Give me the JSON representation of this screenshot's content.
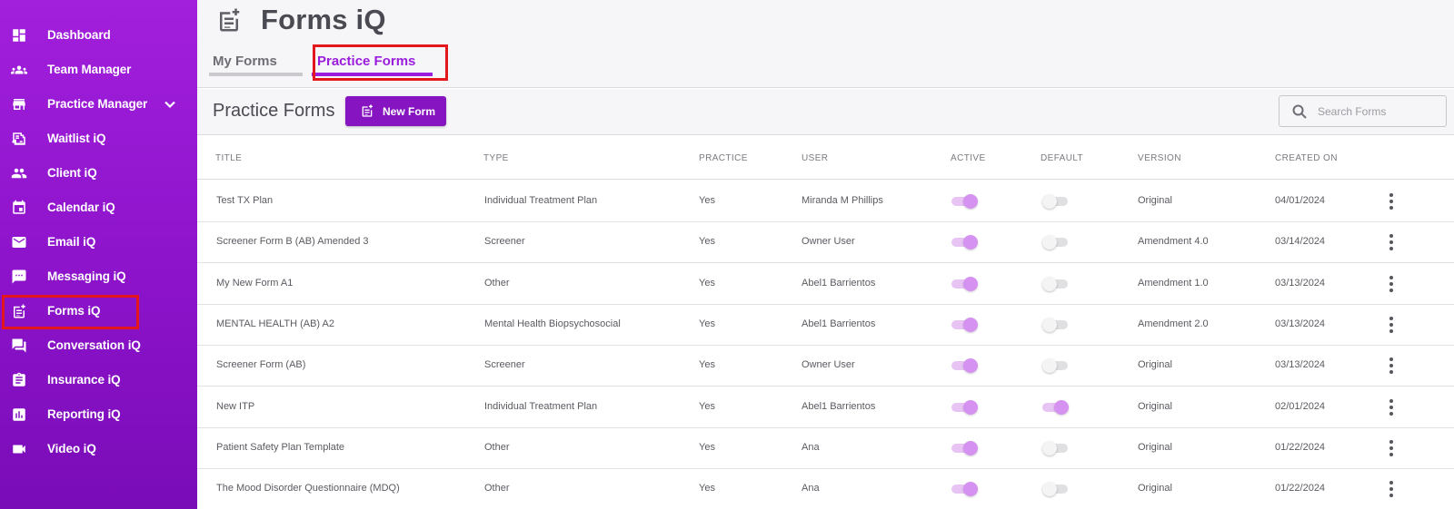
{
  "sidebar": {
    "items": [
      {
        "label": "Dashboard",
        "icon": "dashboard-icon"
      },
      {
        "label": "Team Manager",
        "icon": "team-icon"
      },
      {
        "label": "Practice Manager",
        "icon": "store-icon",
        "expandable": true
      },
      {
        "label": "Waitlist iQ",
        "icon": "waitlist-icon"
      },
      {
        "label": "Client iQ",
        "icon": "client-icon"
      },
      {
        "label": "Calendar iQ",
        "icon": "calendar-icon"
      },
      {
        "label": "Email iQ",
        "icon": "email-icon"
      },
      {
        "label": "Messaging iQ",
        "icon": "messaging-icon"
      },
      {
        "label": "Forms iQ",
        "icon": "forms-icon",
        "active": true
      },
      {
        "label": "Conversation iQ",
        "icon": "conversation-icon"
      },
      {
        "label": "Insurance iQ",
        "icon": "insurance-icon"
      },
      {
        "label": "Reporting iQ",
        "icon": "reporting-icon"
      },
      {
        "label": "Video iQ",
        "icon": "video-icon"
      }
    ]
  },
  "header": {
    "title": "Forms iQ",
    "icon": "forms-icon",
    "tabs": [
      {
        "label": "My Forms",
        "active": false
      },
      {
        "label": "Practice Forms",
        "active": true
      }
    ]
  },
  "toolbar": {
    "section_title": "Practice Forms",
    "new_form_label": "New Form",
    "search_placeholder": "Search Forms"
  },
  "table": {
    "columns": [
      "TITLE",
      "TYPE",
      "PRACTICE",
      "USER",
      "ACTIVE",
      "DEFAULT",
      "VERSION",
      "CREATED ON"
    ],
    "rows": [
      {
        "title": "Test TX Plan",
        "type": "Individual Treatment Plan",
        "practice": "Yes",
        "user": "Miranda M Phillips",
        "active": true,
        "default": false,
        "version": "Original",
        "created": "04/01/2024"
      },
      {
        "title": "Screener Form B (AB) Amended 3",
        "type": "Screener",
        "practice": "Yes",
        "user": "Owner User",
        "active": true,
        "default": false,
        "version": "Amendment 4.0",
        "created": "03/14/2024"
      },
      {
        "title": "My New Form A1",
        "type": "Other",
        "practice": "Yes",
        "user": "Abel1 Barrientos",
        "active": true,
        "default": false,
        "version": "Amendment 1.0",
        "created": "03/13/2024"
      },
      {
        "title": "MENTAL HEALTH (AB) A2",
        "type": "Mental Health Biopsychosocial",
        "practice": "Yes",
        "user": "Abel1 Barrientos",
        "active": true,
        "default": false,
        "version": "Amendment 2.0",
        "created": "03/13/2024"
      },
      {
        "title": "Screener Form (AB)",
        "type": "Screener",
        "practice": "Yes",
        "user": "Owner User",
        "active": true,
        "default": false,
        "version": "Original",
        "created": "03/13/2024"
      },
      {
        "title": "New ITP",
        "type": "Individual Treatment Plan",
        "practice": "Yes",
        "user": "Abel1 Barrientos",
        "active": true,
        "default": true,
        "version": "Original",
        "created": "02/01/2024"
      },
      {
        "title": "Patient Safety Plan Template",
        "type": "Other",
        "practice": "Yes",
        "user": "Ana",
        "active": true,
        "default": false,
        "version": "Original",
        "created": "01/22/2024"
      },
      {
        "title": "The Mood Disorder Questionnaire (MDQ)",
        "type": "Other",
        "practice": "Yes",
        "user": "Ana",
        "active": true,
        "default": false,
        "version": "Original",
        "created": "01/22/2024"
      }
    ]
  },
  "colors": {
    "sidebar_top": "#a21fdc",
    "sidebar_bottom": "#7a0cb8",
    "accent": "#8614c0",
    "tab_active": "#9a1ddd",
    "highlight_box": "#e3161e",
    "toggle_on": "#d592f0"
  }
}
